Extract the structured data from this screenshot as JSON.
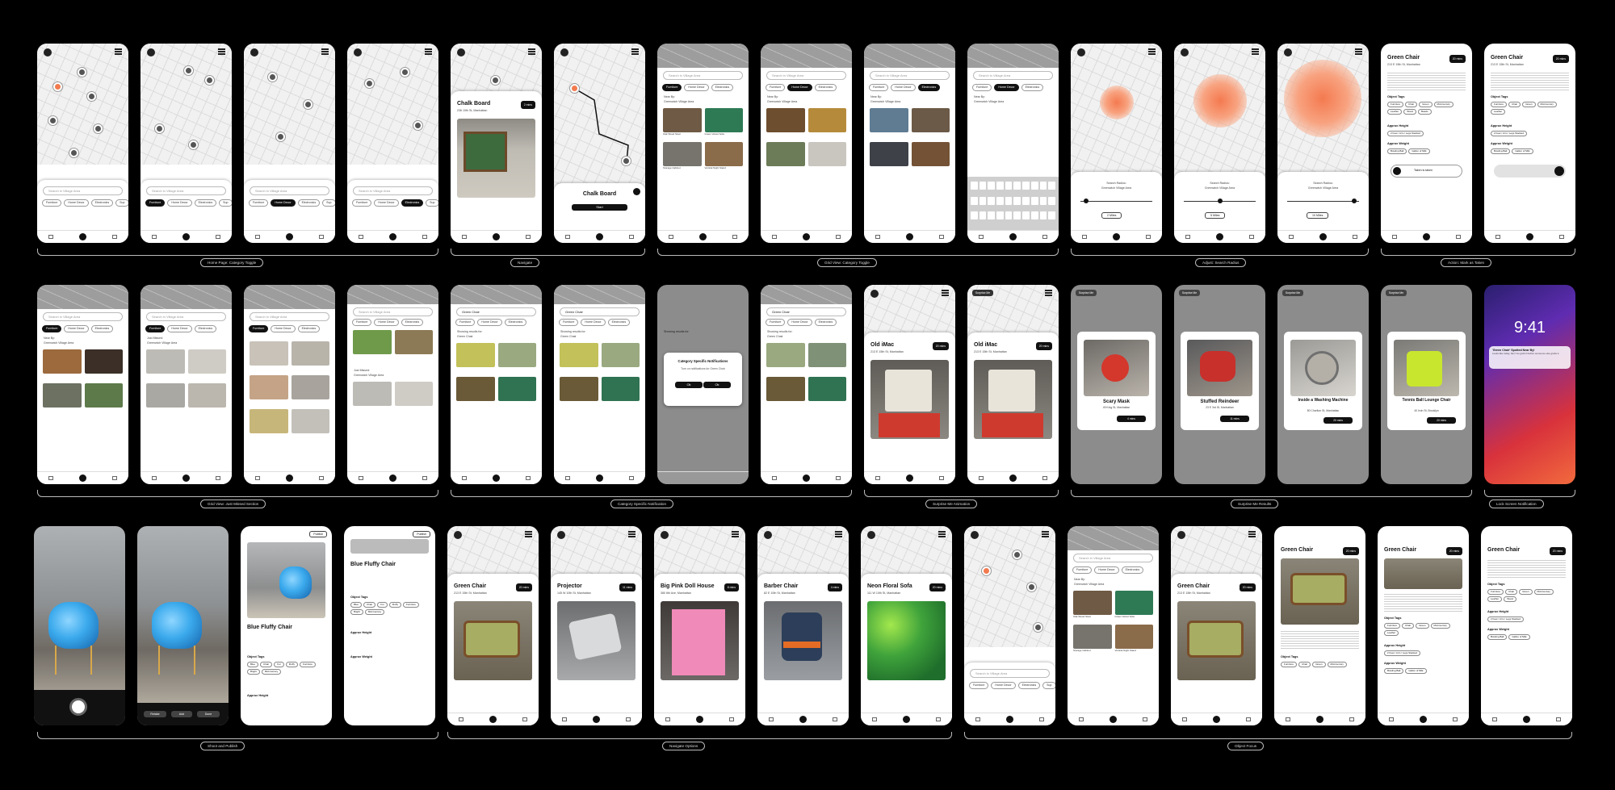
{
  "flows": [
    {
      "label": "Home Page: Category Toggle"
    },
    {
      "label": "Navigate"
    },
    {
      "label": "Grid View: Category Toggle"
    },
    {
      "label": "Adjust: Search Radius"
    },
    {
      "label": "Action: Mark as Taken"
    },
    {
      "label": "Grid View: Just Missed Section"
    },
    {
      "label": "Category Specific Notification"
    },
    {
      "label": "Surprise Me Animation"
    },
    {
      "label": "Surprise Me Results"
    },
    {
      "label": "Lock Screen Notification"
    },
    {
      "label": "Shoot and Publish"
    },
    {
      "label": "Navigate Options"
    },
    {
      "label": "Object Focus"
    }
  ],
  "common": {
    "search_placeholder": "Search in Village Area",
    "near_by": "Near By:",
    "area": "Greenwich Village Area",
    "categories": [
      "Furniture",
      "Home Decor",
      "Electronics",
      "Sup"
    ],
    "search_radius": "Search Radius:",
    "radius_options": [
      "2 Miles",
      "5 Miles",
      "10 Miles"
    ],
    "just_missed": "Just Missed:",
    "showing_results": "Showing results for:",
    "start": "Start",
    "publish": "Publish",
    "object_tags": "Object Tags",
    "approx_height": "Approx Height",
    "approx_weight": "Approx Weight",
    "mark_taken": "Taken is taken",
    "surprise_me": "Surprise Me"
  },
  "items": {
    "chalk_board": {
      "name": "Chalk Board",
      "address": "236 10th St, Manhattan",
      "eta": "2 mins"
    },
    "green_chair": {
      "name": "Green Chair",
      "address": "213 E 15th St, Manhattan",
      "eta": "20 mins",
      "desc_date": "Today, 2:34 PM:",
      "tags": [
        "Furniture",
        "Chair",
        "Green",
        "Mid-Century",
        "Leather",
        "Wood",
        "Beads"
      ],
      "height": "2 Feet / Arm / Legs Stacked",
      "weight": [
        "Bowling Ball",
        "Gallon of Milk"
      ]
    },
    "old_imac": {
      "name": "Old iMac",
      "address": "213 E 15th St, Manhattan",
      "eta": "20 mins"
    },
    "scary_mask": {
      "name": "Scary Mask",
      "address": "49 King St, Manhattan",
      "eta": "4 mins"
    },
    "stuffed_reindeer": {
      "name": "Stuffed Reindeer",
      "address": "23 E 3rd St, Manhattan",
      "eta": "11 mins"
    },
    "washing_machine": {
      "name": "Inside a Washing Machine",
      "address": "80 Charlton St, Manhattan",
      "eta": "20 mins"
    },
    "tennis_chair": {
      "name": "Tennis Ball Lounge Chair",
      "address": "40 Irvin St, Brooklyn",
      "eta": "20 mins"
    },
    "blue_chair": {
      "name": "Blue Fluffy Chair",
      "tags": [
        "Blue",
        "Chair",
        "Fur",
        "Fluffy",
        "Furniture",
        "Bright",
        "Mid-Century"
      ]
    },
    "projector": {
      "name": "Projector",
      "address": "145 W 10th St, Manhattan",
      "eta": "11 mins"
    },
    "dollhouse": {
      "name": "Big Pink Doll House",
      "address": "380 6th Ave, Manhattan",
      "eta": "8 mins"
    },
    "barber_chair": {
      "name": "Barber Chair",
      "address": "82 E 10th St, Manhattan",
      "eta": "4 mins"
    },
    "floral_sofa": {
      "name": "Neon Floral Sofa",
      "address": "111 W 10th St, Manhattan",
      "eta": "20 mins"
    }
  },
  "grid_captions": [
    "Oak Wood Stool",
    "Green Velvet Sofa",
    "Storage Cabinet",
    "Vertical Night Stand"
  ],
  "notification_modal": {
    "title": "Category Specific Notifications",
    "body": "Turn on notifications for Green Chair",
    "ok": "Ok"
  },
  "lock_screen": {
    "time": "9:41",
    "title": "'Green Chair' Spotted Near By!",
    "body": "Looks like today, fam! Go grab it before someone else grabs it."
  },
  "camera": {
    "retake": "Retake",
    "add": "Add",
    "done": "Done"
  },
  "search_query": "Green Chair"
}
